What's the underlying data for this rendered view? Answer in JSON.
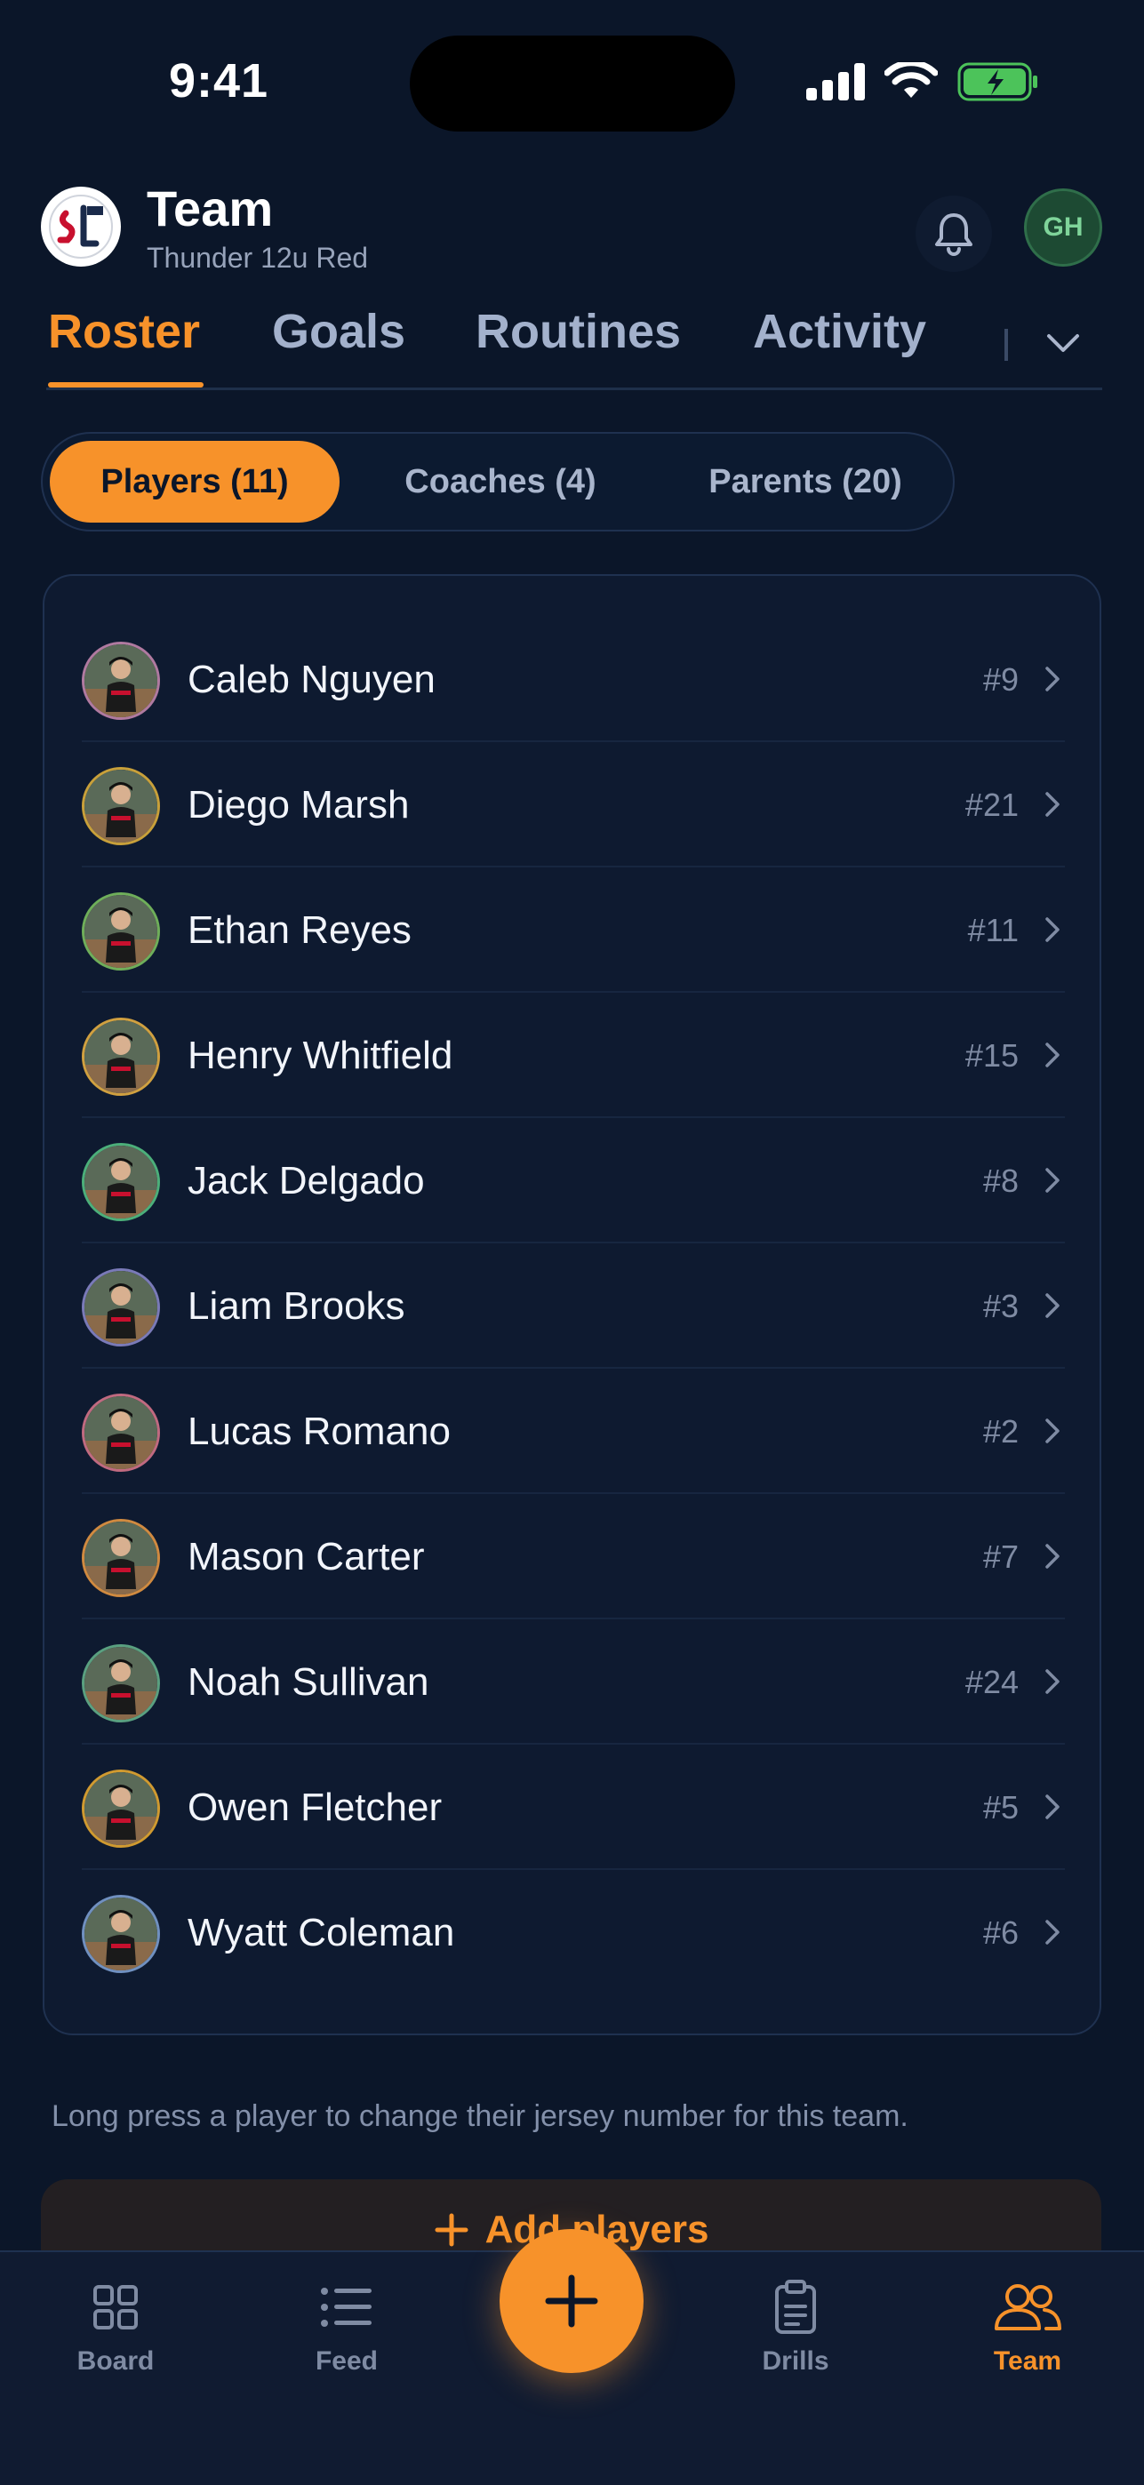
{
  "status_bar": {
    "time": "9:41"
  },
  "header": {
    "title": "Team",
    "subtitle": "Thunder 12u Red",
    "avatar_initials": "GH"
  },
  "tabs": [
    {
      "label": "Roster",
      "active": true
    },
    {
      "label": "Goals",
      "active": false
    },
    {
      "label": "Routines",
      "active": false
    },
    {
      "label": "Activity",
      "active": false
    }
  ],
  "segments": [
    {
      "label": "Players (11)",
      "active": true
    },
    {
      "label": "Coaches (4)",
      "active": false
    },
    {
      "label": "Parents (20)",
      "active": false
    }
  ],
  "players": [
    {
      "name": "Caleb Nguyen",
      "number": "#9",
      "ring": "#b07aa0"
    },
    {
      "name": "Diego Marsh",
      "number": "#21",
      "ring": "#c8a03a"
    },
    {
      "name": "Ethan Reyes",
      "number": "#11",
      "ring": "#6fae5a"
    },
    {
      "name": "Henry Whitfield",
      "number": "#15",
      "ring": "#d0a040"
    },
    {
      "name": "Jack Delgado",
      "number": "#8",
      "ring": "#4caf7a"
    },
    {
      "name": "Liam Brooks",
      "number": "#3",
      "ring": "#7a7ab8"
    },
    {
      "name": "Lucas Romano",
      "number": "#2",
      "ring": "#c06a80"
    },
    {
      "name": "Mason Carter",
      "number": "#7",
      "ring": "#d08a40"
    },
    {
      "name": "Noah Sullivan",
      "number": "#24",
      "ring": "#5aa080"
    },
    {
      "name": "Owen Fletcher",
      "number": "#5",
      "ring": "#d09a30"
    },
    {
      "name": "Wyatt Coleman",
      "number": "#6",
      "ring": "#7090c0"
    }
  ],
  "hint": "Long press a player to change their jersey number for this team.",
  "add_players_label": "Add players",
  "bottom_nav": [
    {
      "label": "Board",
      "icon": "grid-icon",
      "active": false
    },
    {
      "label": "Feed",
      "icon": "list-icon",
      "active": false
    },
    {
      "label": "Drills",
      "icon": "clipboard-icon",
      "active": false
    },
    {
      "label": "Team",
      "icon": "people-icon",
      "active": true
    }
  ],
  "colors": {
    "accent": "#f7922a",
    "background": "#0b1629",
    "card": "#0e1a30"
  }
}
